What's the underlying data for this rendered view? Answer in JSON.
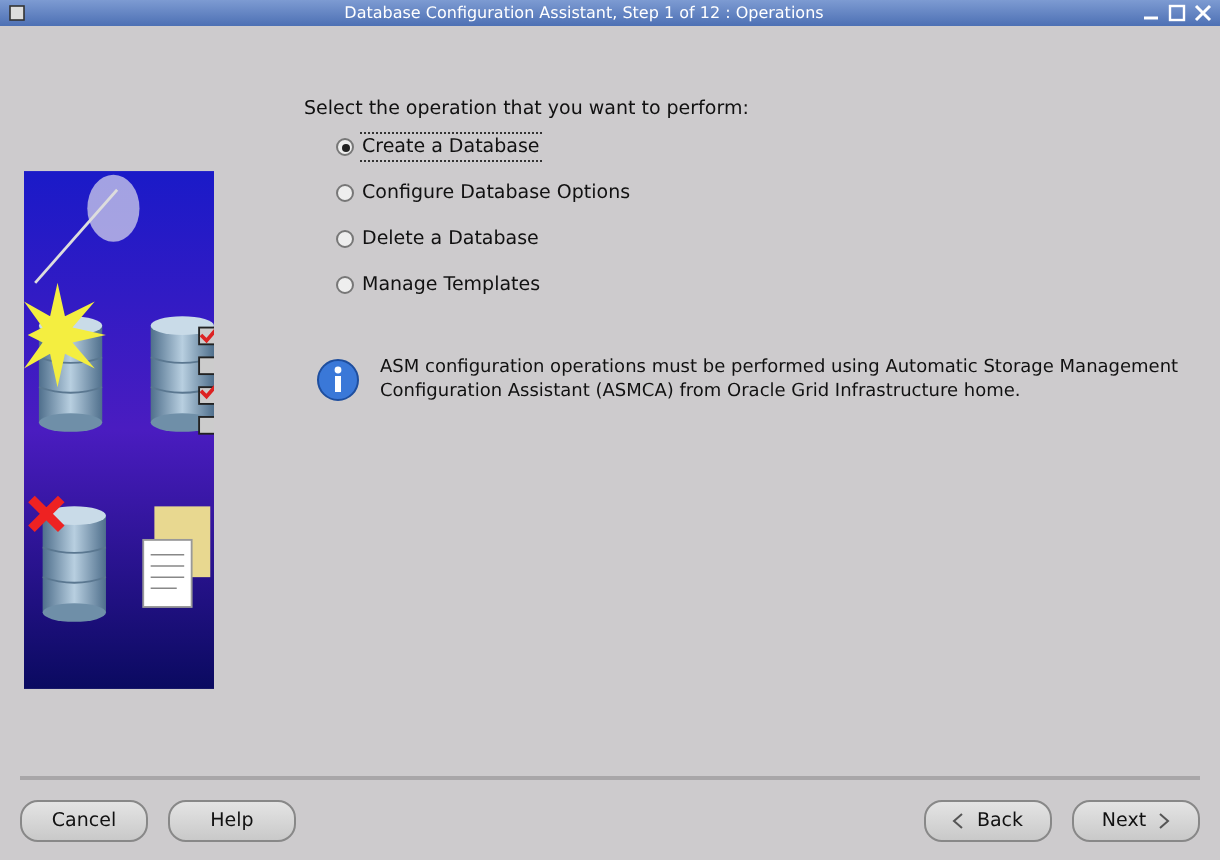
{
  "window": {
    "title": "Database Configuration Assistant, Step 1 of 12 : Operations"
  },
  "prompt": "Select the operation that you want to perform:",
  "operations": [
    {
      "label": "Create a Database",
      "selected": true
    },
    {
      "label": "Configure Database Options",
      "selected": false
    },
    {
      "label": "Delete a Database",
      "selected": false
    },
    {
      "label": "Manage Templates",
      "selected": false
    }
  ],
  "info": "ASM configuration operations must be performed using Automatic Storage Management Configuration Assistant (ASMCA) from Oracle Grid Infrastructure home.",
  "buttons_left": [
    "Cancel",
    "Help"
  ],
  "buttons_right": [
    {
      "label": "Back",
      "kind": "back"
    },
    {
      "label": "Next",
      "kind": "next"
    }
  ]
}
